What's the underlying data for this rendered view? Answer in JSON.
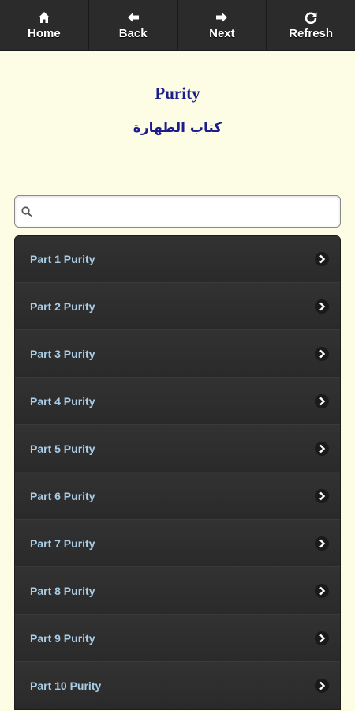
{
  "toolbar": {
    "home_label": "Home",
    "back_label": "Back",
    "next_label": "Next",
    "refresh_label": "Refresh"
  },
  "header": {
    "title_en": "Purity",
    "title_ar": "كتاب الطهارة"
  },
  "search": {
    "value": "",
    "placeholder": ""
  },
  "list": {
    "items": [
      {
        "label": "Part 1 Purity"
      },
      {
        "label": "Part 2 Purity"
      },
      {
        "label": "Part 3 Purity"
      },
      {
        "label": "Part 4 Purity"
      },
      {
        "label": "Part 5 Purity"
      },
      {
        "label": "Part 6 Purity"
      },
      {
        "label": "Part 7 Purity"
      },
      {
        "label": "Part 8 Purity"
      },
      {
        "label": "Part 9 Purity"
      },
      {
        "label": "Part 10 Purity"
      }
    ]
  },
  "colors": {
    "background": "#fdfde6",
    "navbar": "#2b2b2b",
    "title": "#1c1c8a",
    "list_bg": "#2c2c2c",
    "item_text": "#a9cde6"
  }
}
